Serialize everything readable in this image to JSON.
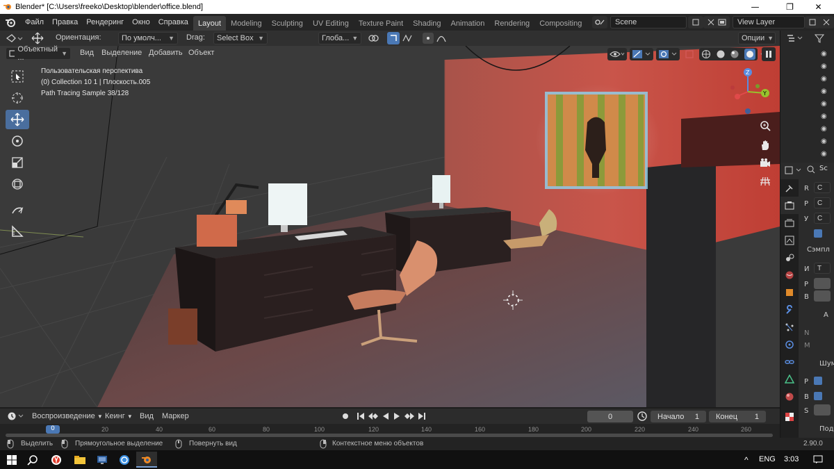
{
  "window": {
    "title": "Blender* [C:\\Users\\freeko\\Desktop\\blender\\office.blend]",
    "minimize": "—",
    "maximize": "❐",
    "close": "✕"
  },
  "menu": {
    "items": [
      "Файл",
      "Правка",
      "Рендеринг",
      "Окно",
      "Справка"
    ]
  },
  "workspaces": [
    "Layout",
    "Modeling",
    "Sculpting",
    "UV Editing",
    "Texture Paint",
    "Shading",
    "Animation",
    "Rendering",
    "Compositing",
    "Sc"
  ],
  "scene": {
    "name": "Scene",
    "view_layer": "View Layer"
  },
  "header": {
    "orientation_label": "Ориентация:",
    "orientation_value": "По умолч...",
    "drag_label": "Drag:",
    "drag_value": "Select Box",
    "transform_value": "Глоба...",
    "options": "Опции"
  },
  "viewport_menu": {
    "mode": "Объектный ...",
    "items": [
      "Вид",
      "Выделение",
      "Добавить",
      "Объект"
    ]
  },
  "overlay": {
    "line1": "Пользовательская перспектива",
    "line2": "(0) Collection 10 1 | Плоскость.005",
    "line3": "Path Tracing Sample 38/128"
  },
  "properties": {
    "header": "Sc",
    "rows": [
      "R",
      "P",
      "У",
      "Сэмпл",
      "И",
      "P",
      "B",
      "A",
      "N",
      "M",
      "Шум",
      "P",
      "B",
      "S",
      "Под"
    ],
    "dropdown_c": "C",
    "dropdown_t": "T"
  },
  "timeline": {
    "playback": "Воспроизведение",
    "keying": "Кеинг",
    "view": "Вид",
    "marker": "Маркер",
    "current_frame": "0",
    "start_label": "Начало",
    "start_value": "1",
    "end_label": "Конец",
    "end_value": "1",
    "ruler_current": "0",
    "ticks": [
      "20",
      "40",
      "60",
      "80",
      "100",
      "120",
      "140",
      "160",
      "180",
      "200",
      "220",
      "240",
      "260"
    ]
  },
  "status": {
    "select": "Выделить",
    "box_select": "Прямоугольное выделение",
    "rotate": "Повернуть вид",
    "context": "Контекстное меню объектов",
    "version": "2.90.0"
  },
  "taskbar": {
    "lang": "ENG",
    "time": "3:03",
    "caret": "^"
  },
  "colors": {
    "accent": "#4a78b5",
    "active_tool": "#4a6e9e",
    "room_light": "#c2453a"
  },
  "icons": [
    "blender-icon",
    "move-icon",
    "cursor-icon",
    "rotate-icon",
    "scale-icon",
    "transform-icon",
    "annotate-icon",
    "measure-icon",
    "zoom-icon",
    "hand-icon",
    "camera-icon",
    "grid-icon",
    "eye-icon",
    "windows-icon",
    "search-icon"
  ]
}
